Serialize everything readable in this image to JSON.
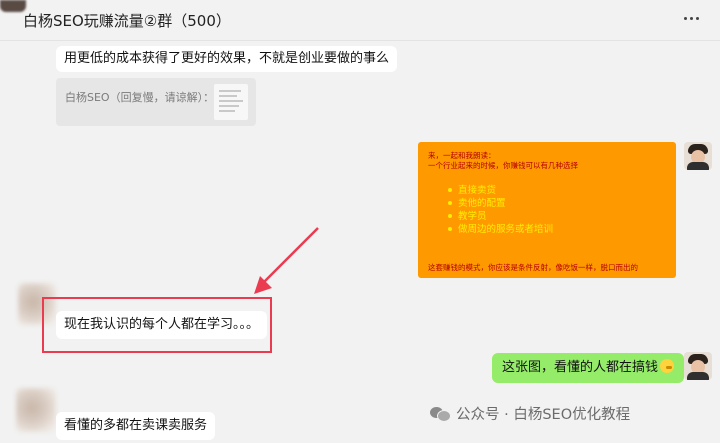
{
  "header": {
    "title": "白杨SEO玩赚流量②群（500）"
  },
  "messages": {
    "m1": "用更低的成本获得了更好的效果，不就是创业要做的事么",
    "quote": "白杨SEO（回复慢，请谅解）：",
    "m2": "现在我认识的每个人都在学习。。。",
    "green": "这张图，看懂的人都在搞钱",
    "m3": "看懂的多都在卖课卖服务"
  },
  "poster": {
    "line1": "来，一起和我朗读：",
    "line2": "一个行业起来的时候，你赚钱可以有几种选择",
    "items": [
      "直接卖货",
      "卖他的配置",
      "教学员",
      "做周边的服务或者培训"
    ],
    "footer": "这套赚钱的模式，你应该是条件反射，像吃饭一样，脱口而出的"
  },
  "watermark": {
    "text": "公众号 · 白杨SEO优化教程"
  },
  "colors": {
    "background": "#f2f2f2",
    "green_bubble": "#95ec69",
    "poster_bg": "#ff9900",
    "annotation_red": "#ea3b50"
  }
}
